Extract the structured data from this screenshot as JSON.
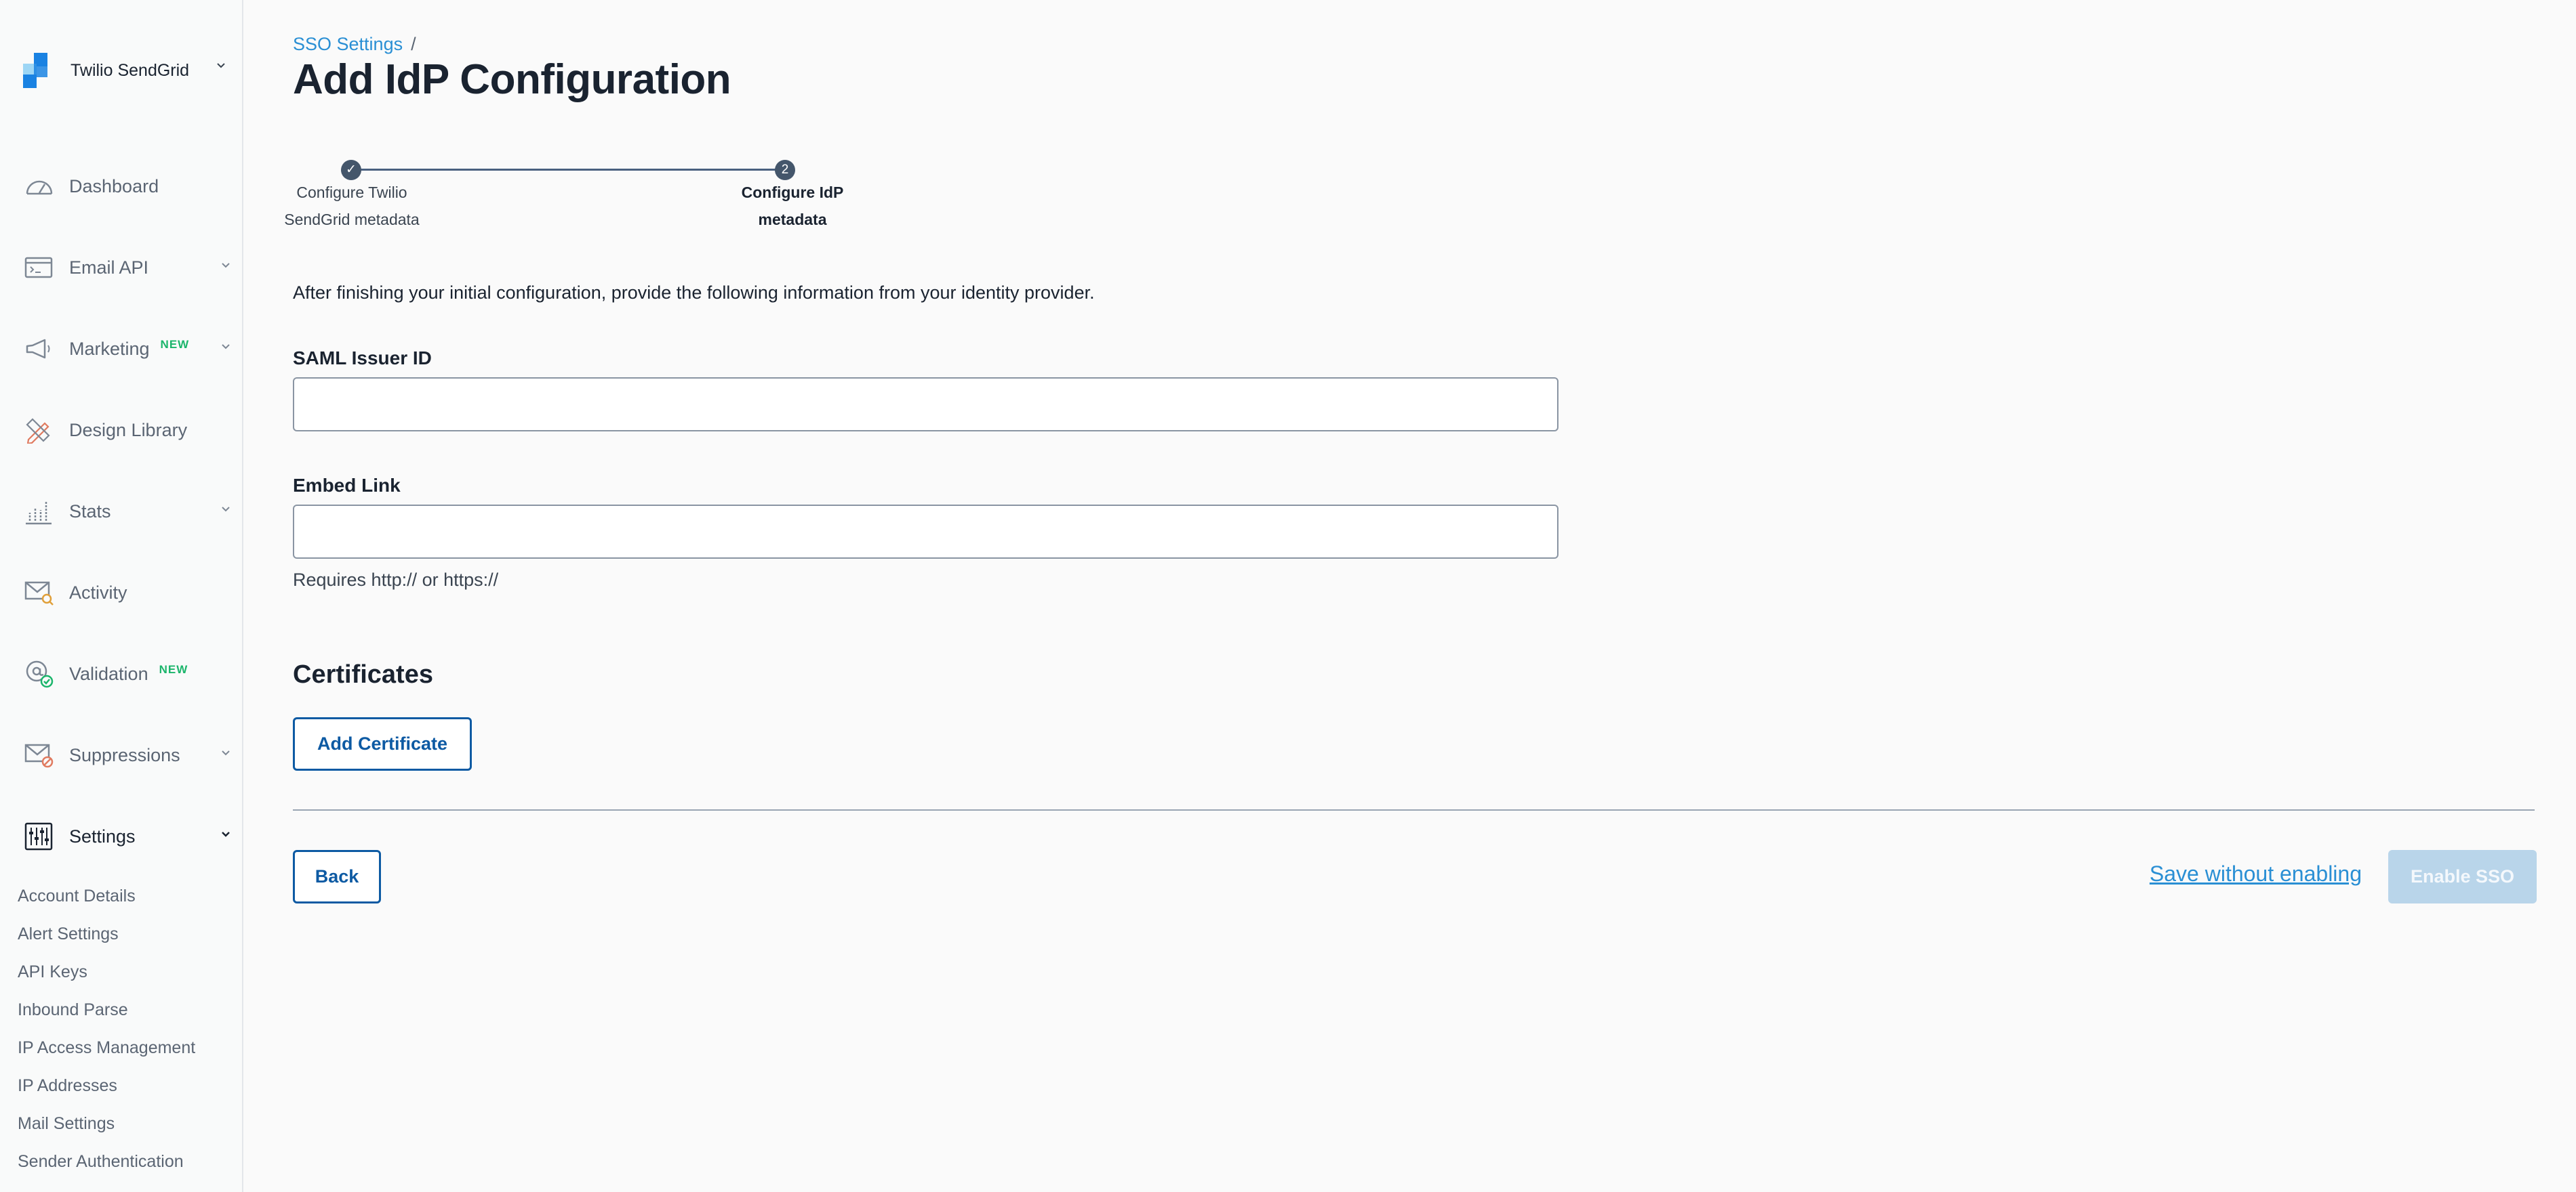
{
  "sidebar": {
    "account_name": "Twilio SendGrid",
    "nav": [
      {
        "label": "Dashboard",
        "icon": "speedometer-icon",
        "expandable": false
      },
      {
        "label": "Email API",
        "icon": "code-window-icon",
        "expandable": true
      },
      {
        "label": "Marketing",
        "icon": "megaphone-icon",
        "expandable": true,
        "badge": "NEW"
      },
      {
        "label": "Design Library",
        "icon": "pencil-ruler-icon",
        "expandable": false
      },
      {
        "label": "Stats",
        "icon": "bar-chart-icon",
        "expandable": true
      },
      {
        "label": "Activity",
        "icon": "envelope-search-icon",
        "expandable": false
      },
      {
        "label": "Validation",
        "icon": "at-check-icon",
        "expandable": false,
        "badge": "NEW"
      },
      {
        "label": "Suppressions",
        "icon": "envelope-blocked-icon",
        "expandable": true
      },
      {
        "label": "Settings",
        "icon": "sliders-icon",
        "expandable": true,
        "active": true
      }
    ],
    "settings_items": [
      "Account Details",
      "Alert Settings",
      "API Keys",
      "Inbound Parse",
      "IP Access Management",
      "IP Addresses",
      "Mail Settings",
      "Sender Authentication"
    ]
  },
  "breadcrumb": {
    "parent": "SSO Settings",
    "separator": "/"
  },
  "page_title": "Add IdP Configuration",
  "stepper": {
    "steps": [
      {
        "number": "✓",
        "line1": "Configure Twilio",
        "line2": "SendGrid metadata",
        "status": "complete"
      },
      {
        "number": "2",
        "line1": "Configure IdP",
        "line2": "metadata",
        "status": "current"
      }
    ]
  },
  "intro_text": "After finishing your initial configuration, provide the following information from your identity provider.",
  "form": {
    "saml_issuer_label": "SAML Issuer ID",
    "saml_issuer_value": "",
    "embed_link_label": "Embed Link",
    "embed_link_value": "",
    "embed_link_help": "Requires http:// or https://"
  },
  "certificates": {
    "heading": "Certificates",
    "add_label": "Add Certificate"
  },
  "footer": {
    "back_label": "Back",
    "save_label": "Save without enabling",
    "enable_label": "Enable SSO"
  },
  "colors": {
    "accent": "#0d5aa3",
    "link": "#2a8fd4",
    "badge_green": "#1bb56b",
    "disabled_button": "#b9d5ea"
  }
}
